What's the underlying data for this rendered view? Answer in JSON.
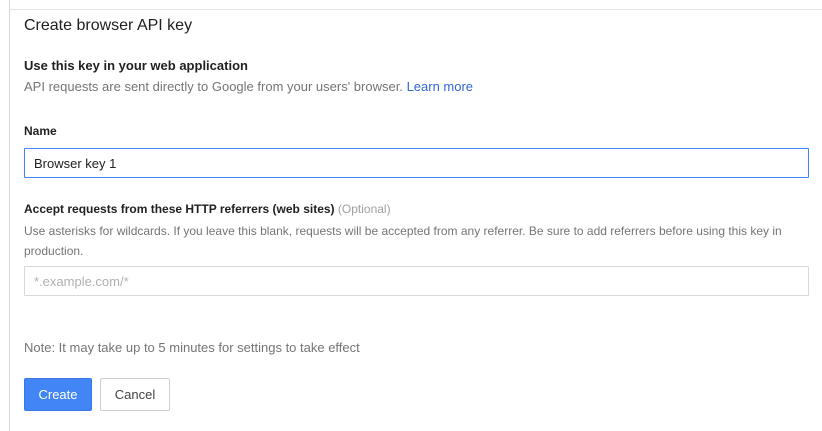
{
  "dialog": {
    "title": "Create browser API key"
  },
  "usage": {
    "heading": "Use this key in your web application",
    "description": "API requests are sent directly to Google from your users' browser.",
    "learn_more": "Learn more"
  },
  "name_field": {
    "label": "Name",
    "value": "Browser key 1"
  },
  "referrers_field": {
    "label": "Accept requests from these HTTP referrers (web sites)",
    "optional": "(Optional)",
    "help": "Use asterisks for wildcards. If you leave this blank, requests will be accepted from any referrer. Be sure to add referrers before using this key in production.",
    "placeholder": "*.example.com/*",
    "value": ""
  },
  "note": "Note: It may take up to 5 minutes for settings to take effect",
  "actions": {
    "create_label": "Create",
    "cancel_label": "Cancel"
  },
  "colors": {
    "accent": "#4285f4",
    "link": "#3367d6",
    "muted_text": "#757575"
  }
}
